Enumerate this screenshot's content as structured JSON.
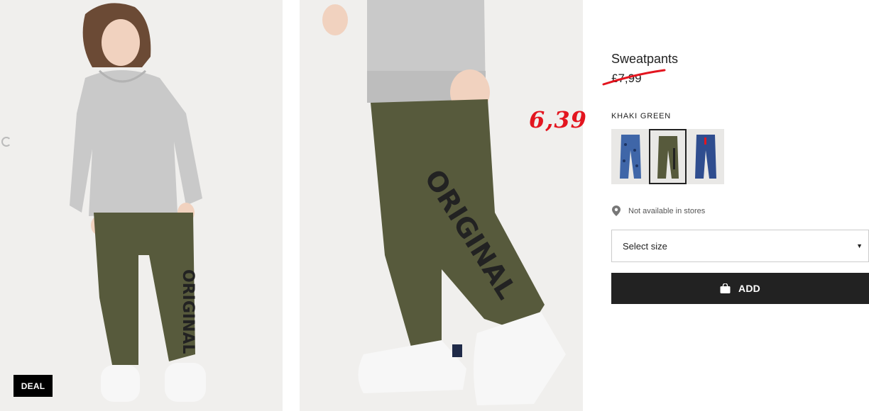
{
  "product": {
    "title": "Sweatpants",
    "old_price": "£7,99",
    "new_price": "6,39",
    "color_label": "KHAKI GREEN",
    "selected_swatch": 2
  },
  "gallery": {
    "badge": "DEAL",
    "pants_print": "ORIGINAL"
  },
  "availability": {
    "text": "Not available in stores",
    "icon": "location-pin-icon"
  },
  "size_select": {
    "label": "Select size",
    "icon": "caret-down-icon"
  },
  "add_button": {
    "label": "ADD",
    "icon": "shopping-bag-icon"
  },
  "colors": {
    "khaki": "#575a3c",
    "grey_hoodie": "#c9c9c9",
    "blue_pattern": "#3f66a8",
    "navy": "#2f4d8f",
    "accent_red": "#e3151f",
    "button": "#222222"
  }
}
